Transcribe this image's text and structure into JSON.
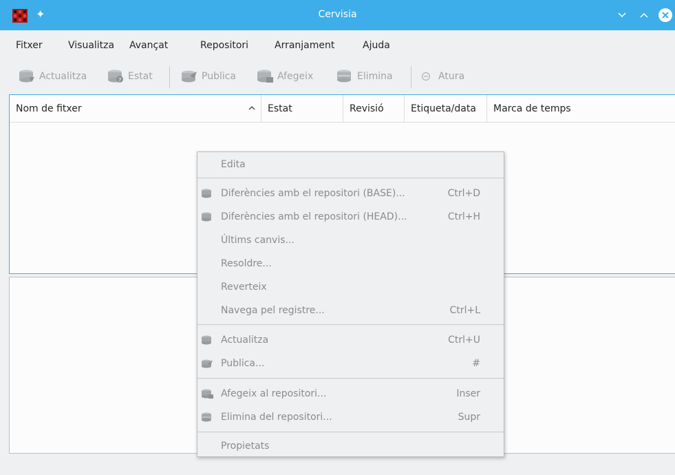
{
  "window": {
    "title": "Cervisia",
    "controls": [
      "chevron-down",
      "chevron-up",
      "close"
    ]
  },
  "menubar": [
    "Fitxer",
    "Visualitza",
    "Avançat",
    "Repositori",
    "Arranjament",
    "Ajuda"
  ],
  "toolbar": {
    "update": "Actualitza",
    "status": "Estat",
    "commit": "Publica",
    "add": "Afegeix",
    "remove": "Elimina",
    "stop": "Atura"
  },
  "filelist": {
    "columns": [
      "Nom de fitxer",
      "Estat",
      "Revisió",
      "Etiqueta/data",
      "Marca de temps"
    ],
    "sort_indicator": "^"
  },
  "context_menu": {
    "items": [
      {
        "label": "Edita",
        "shortcut": "",
        "icon": ""
      },
      {
        "label": "Diferències amb el repositori (BASE)...",
        "shortcut": "Ctrl+D",
        "icon": "diff-icon"
      },
      {
        "label": "Diferències amb el repositori (HEAD)...",
        "shortcut": "Ctrl+H",
        "icon": "diff-icon"
      },
      {
        "label": "Últims canvis...",
        "shortcut": "",
        "icon": ""
      },
      {
        "label": "Resoldre...",
        "shortcut": "",
        "icon": ""
      },
      {
        "label": "Reverteix",
        "shortcut": "",
        "icon": ""
      },
      {
        "label": "Navega pel registre...",
        "shortcut": "Ctrl+L",
        "icon": ""
      },
      {
        "label": "Actualitza",
        "shortcut": "Ctrl+U",
        "icon": "update-icon"
      },
      {
        "label": "Publica...",
        "shortcut": "#",
        "icon": "commit-icon"
      },
      {
        "label": "Afegeix al repositori...",
        "shortcut": "Inser",
        "icon": "add-icon"
      },
      {
        "label": "Elimina del repositori...",
        "shortcut": "Supr",
        "icon": "remove-icon"
      },
      {
        "label": "Propietats",
        "shortcut": "",
        "icon": ""
      }
    ]
  },
  "colors": {
    "titlebar": "#3daee9",
    "disabled_text": "#898b8e",
    "focus_border": "#3daee9"
  }
}
